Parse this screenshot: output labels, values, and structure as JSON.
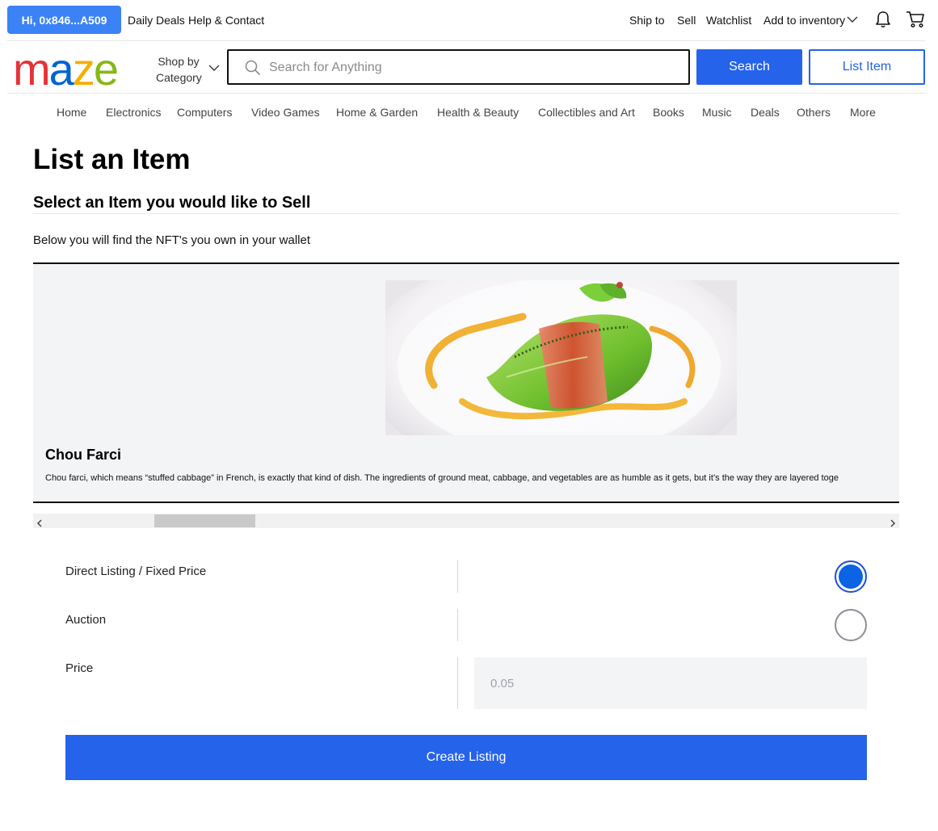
{
  "topbar": {
    "greeting": "Hi, 0x846...A509",
    "daily_deals": "Daily Deals",
    "help": "Help & Contact",
    "ship_to": "Ship to",
    "sell": "Sell",
    "watchlist": "Watchlist",
    "add_inventory": "Add to inventory"
  },
  "header": {
    "logo_letters": [
      "m",
      "a",
      "z",
      "e"
    ],
    "logo_colors": [
      "#e53238",
      "#0064d2",
      "#f5af02",
      "#86b817"
    ],
    "shop_by": "Shop by",
    "category": "Category",
    "search_placeholder": "Search for Anything",
    "search_label": "Search",
    "list_item_label": "List Item"
  },
  "nav": {
    "items": [
      "Home",
      "Electronics",
      "Computers",
      "Video Games",
      "Home & Garden",
      "Health & Beauty",
      "Collectibles and Art",
      "Books",
      "Music",
      "Deals",
      "Others",
      "More"
    ]
  },
  "main": {
    "title": "List an Item",
    "subtitle": "Select an Item you would like to Sell",
    "intro": "Below you will find the NFT's you own in your wallet",
    "nft": {
      "name": "Chou Farci",
      "description": "Chou farci, which means “stuffed cabbage” in French, is exactly that kind of dish. The ingredients of ground meat, cabbage, and vegetables are as humble as it gets, but it’s the way they are layered toge"
    },
    "form": {
      "direct_label": "Direct Listing / Fixed Price",
      "auction_label": "Auction",
      "price_label": "Price",
      "price_placeholder": "0.05",
      "selected_option": "Direct Listing / Fixed Price",
      "create_label": "Create Listing"
    }
  },
  "colors": {
    "accent": "#2563eb",
    "radio_selected": "#0b63e5"
  }
}
